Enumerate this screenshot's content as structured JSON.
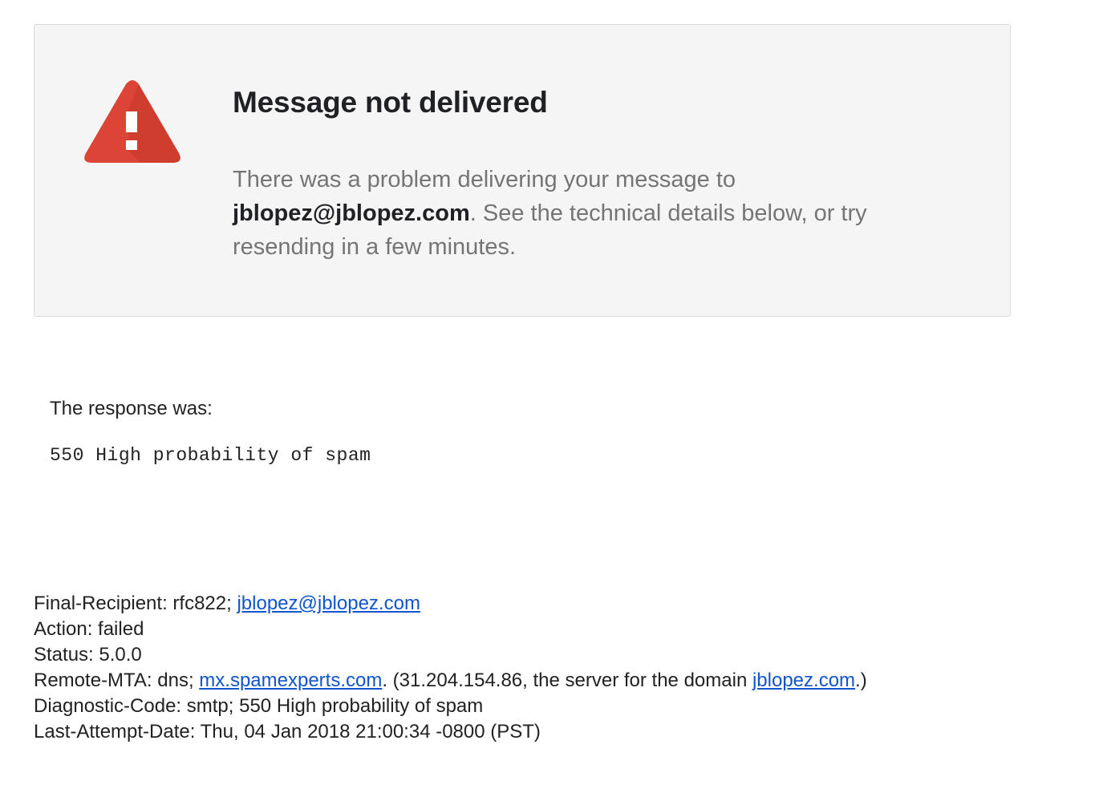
{
  "banner": {
    "title": "Message not delivered",
    "desc_prefix": "There was a problem delivering your message to ",
    "recipient": "jblopez@jblopez.com",
    "desc_suffix": ". See the technical details below, or try resending in a few minutes.",
    "icon": "warning-triangle-icon",
    "icon_color": "#db4437"
  },
  "response": {
    "label": "The response was:",
    "code": "550 High probability of spam"
  },
  "details": {
    "final_recipient_label": "Final-Recipient: rfc822; ",
    "final_recipient_link": "jblopez@jblopez.com",
    "action": "Action: failed",
    "status": "Status: 5.0.0",
    "remote_mta_prefix": "Remote-MTA: dns; ",
    "remote_mta_link": "mx.spamexperts.com",
    "remote_mta_middle": ". (31.204.154.86, the server for the domain ",
    "remote_mta_domain_link": "jblopez.com",
    "remote_mta_suffix": ".)",
    "diagnostic": "Diagnostic-Code: smtp; 550 High probability of spam",
    "last_attempt": "Last-Attempt-Date: Thu, 04 Jan 2018 21:00:34 -0800 (PST)"
  },
  "colors": {
    "link": "#1155cc",
    "banner_bg": "#f5f5f5"
  }
}
